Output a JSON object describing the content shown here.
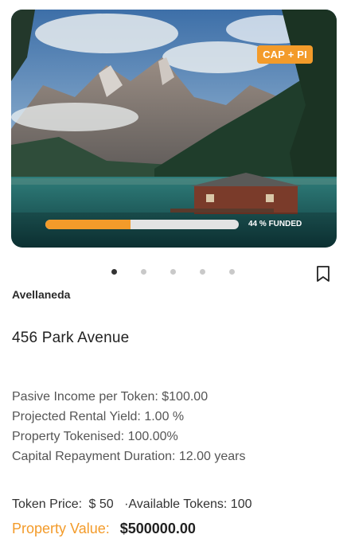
{
  "hero": {
    "badge": "CAP + PI",
    "funded_fraction": 0.44,
    "funded_label": "44 % FUNDED"
  },
  "carousel": {
    "count": 5,
    "active_index": 0
  },
  "bookmark_icon": "bookmark-icon",
  "property": {
    "location": "Avellaneda",
    "title": "456 Park Avenue",
    "stats": [
      "Pasive Income per Token: $100.00",
      "Projected Rental Yield: 1.00 %",
      "Property Tokenised: 100.00%",
      "Capital Repayment Duration: 12.00 years"
    ],
    "token_price_label": "Token Price:",
    "token_price": "$ 50",
    "available_tokens": "·Available Tokens: 100",
    "value_label": "Property Value:",
    "value": "$500000.00"
  },
  "colors": {
    "accent": "#f39b2a"
  }
}
